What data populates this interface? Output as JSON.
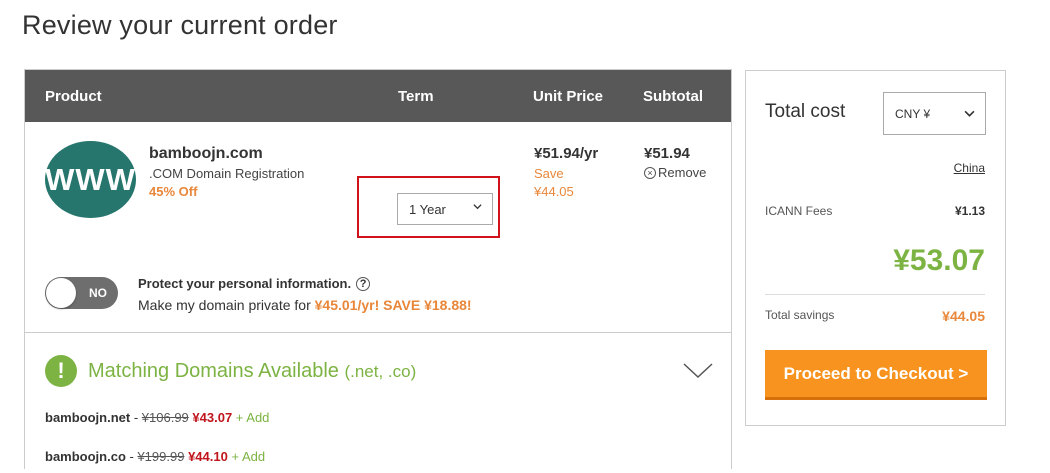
{
  "page": {
    "title": "Review your current order"
  },
  "cart": {
    "headers": {
      "product": "Product",
      "term": "Term",
      "unit_price": "Unit Price",
      "subtotal": "Subtotal"
    },
    "item": {
      "logo_text": "WWW",
      "domain": "bamboojn.com",
      "description": ".COM Domain Registration",
      "discount": "45% Off",
      "term": "1 Year",
      "unit_price": "¥51.94/yr",
      "save_label": "Save",
      "save_amount": "¥44.05",
      "subtotal": "¥51.94",
      "remove_label": "Remove"
    },
    "privacy": {
      "toggle_label": "NO",
      "toggle_on": false,
      "title": "Protect your personal information.",
      "help_icon": "?",
      "text_prefix": "Make my domain private for ",
      "offer": "¥45.01/yr! SAVE ¥18.88!"
    },
    "matching": {
      "icon": "!",
      "title": "Matching Domains Available",
      "tlds": "(.net, .co)",
      "domains": [
        {
          "name": "bamboojn.net",
          "sep": " - ",
          "old_price": "¥106.99",
          "new_price": "¥43.07",
          "add": "+ Add"
        },
        {
          "name": "bamboojn.co",
          "sep": " - ",
          "old_price": "¥199.99",
          "new_price": "¥44.10",
          "add": "+ Add"
        }
      ]
    }
  },
  "summary": {
    "total_cost_label": "Total cost",
    "currency": "CNY ¥",
    "country": "China",
    "icann_label": "ICANN Fees",
    "icann_value": "¥1.13",
    "total": "¥53.07",
    "savings_label": "Total savings",
    "savings_value": "¥44.05",
    "checkout_label": "Proceed to Checkout >"
  },
  "colors": {
    "header_bg": "#585858",
    "accent_green": "#7cb342",
    "accent_orange": "#e8873a",
    "checkout_orange": "#f7931e",
    "logo_teal": "#26766e",
    "highlight_red": "#d0131b",
    "sale_red": "#c0151c"
  },
  "icons": [
    "chevron-down-icon",
    "remove-circle-icon",
    "help-icon",
    "exclamation-icon"
  ]
}
